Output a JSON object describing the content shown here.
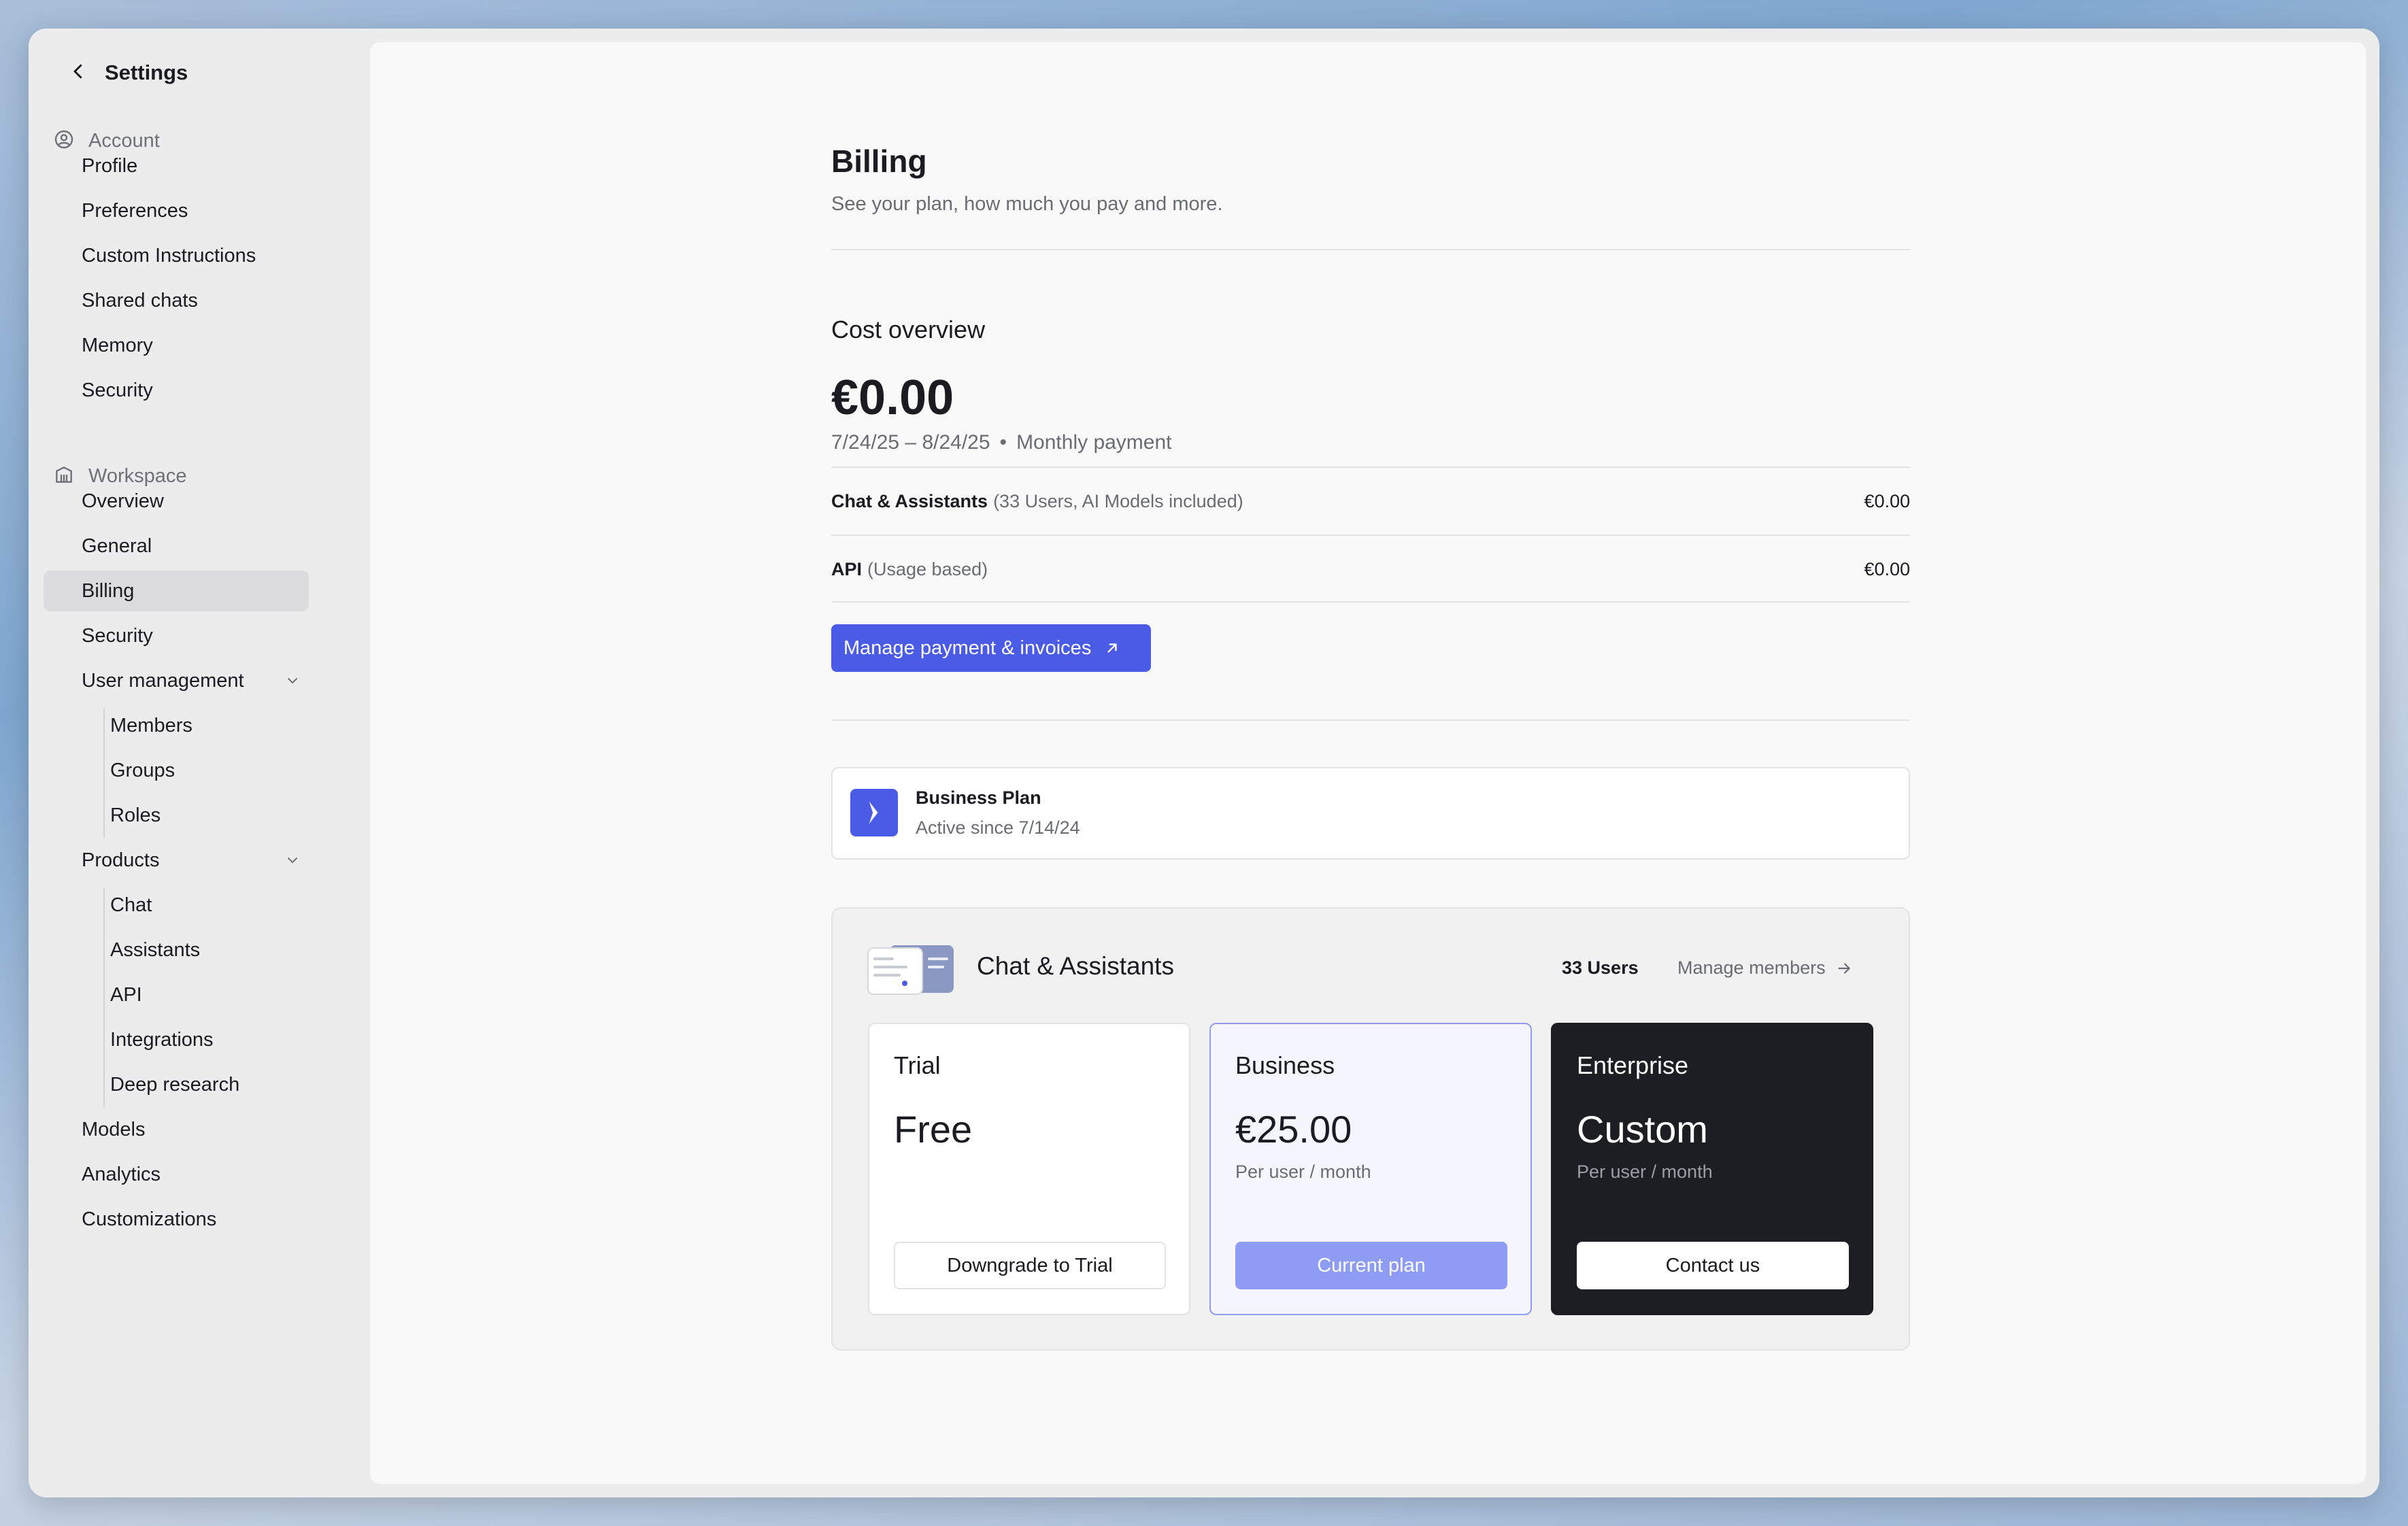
{
  "sidebar": {
    "title": "Settings",
    "account_label": "Account",
    "account_items": [
      "Profile",
      "Preferences",
      "Custom Instructions",
      "Shared chats",
      "Memory",
      "Security"
    ],
    "workspace_label": "Workspace",
    "workspace_items": [
      "Overview",
      "General",
      "Billing",
      "Security"
    ],
    "user_management": {
      "label": "User management",
      "items": [
        "Members",
        "Groups",
        "Roles"
      ]
    },
    "products": {
      "label": "Products",
      "items": [
        "Chat",
        "Assistants",
        "API",
        "Integrations",
        "Deep research"
      ]
    },
    "bottom_items": [
      "Models",
      "Analytics",
      "Customizations"
    ],
    "active_item": "Billing"
  },
  "billing": {
    "title": "Billing",
    "subtitle": "See your plan, how much you pay and more."
  },
  "cost": {
    "title": "Cost overview",
    "total": "€0.00",
    "period": "7/24/25 – 8/24/25",
    "separator": "•",
    "frequency": "Monthly payment",
    "rows": [
      {
        "name": "Chat & Assistants",
        "note": "(33 Users, AI Models included)",
        "amount": "€0.00"
      },
      {
        "name": "API",
        "note": "(Usage based)",
        "amount": "€0.00"
      }
    ],
    "manage_button": "Manage payment & invoices"
  },
  "plan": {
    "name": "Business Plan",
    "since": "Active since 7/14/24"
  },
  "product": {
    "title": "Chat & Assistants",
    "users": "33 Users",
    "manage_members": "Manage members",
    "tiers": [
      {
        "name": "Trial",
        "price": "Free",
        "unit": "",
        "button": "Downgrade to Trial"
      },
      {
        "name": "Business",
        "price": "€25.00",
        "unit": "Per user / month",
        "button": "Current plan"
      },
      {
        "name": "Enterprise",
        "price": "Custom",
        "unit": "Per user / month",
        "button": "Contact us"
      }
    ]
  },
  "colors": {
    "accent": "#4a5be6",
    "current_plan": "#8e9cf3",
    "enterprise_bg": "#1d1e24"
  }
}
